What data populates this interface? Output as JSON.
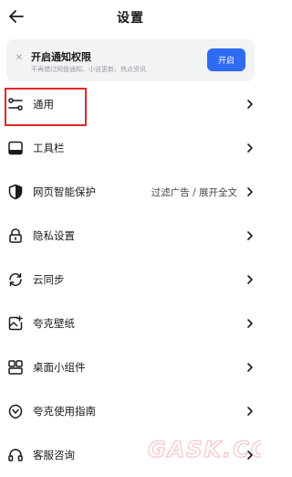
{
  "header": {
    "title": "设置"
  },
  "notice": {
    "title": "开启通知权限",
    "subtitle": "不再错过网盘通知、小说更新、热点资讯",
    "button_label": "开启"
  },
  "menu": {
    "items": [
      {
        "label": "通用",
        "icon": "sliders-icon"
      },
      {
        "label": "工具栏",
        "icon": "toolbar-icon"
      },
      {
        "label": "网页智能保护",
        "icon": "shield-icon",
        "value": "过滤广告 / 展开全文"
      },
      {
        "label": "隐私设置",
        "icon": "lock-icon"
      },
      {
        "label": "云同步",
        "icon": "sync-icon"
      },
      {
        "label": "夸克壁纸",
        "icon": "wallpaper-icon"
      },
      {
        "label": "桌面小组件",
        "icon": "widget-icon"
      },
      {
        "label": "夸克使用指南",
        "icon": "guide-icon"
      },
      {
        "label": "客服咨询",
        "icon": "headset-icon"
      }
    ]
  },
  "watermark": {
    "text": "GASK.CC"
  },
  "colors": {
    "accent": "#2f6bf2",
    "highlight": "#e0282b"
  }
}
